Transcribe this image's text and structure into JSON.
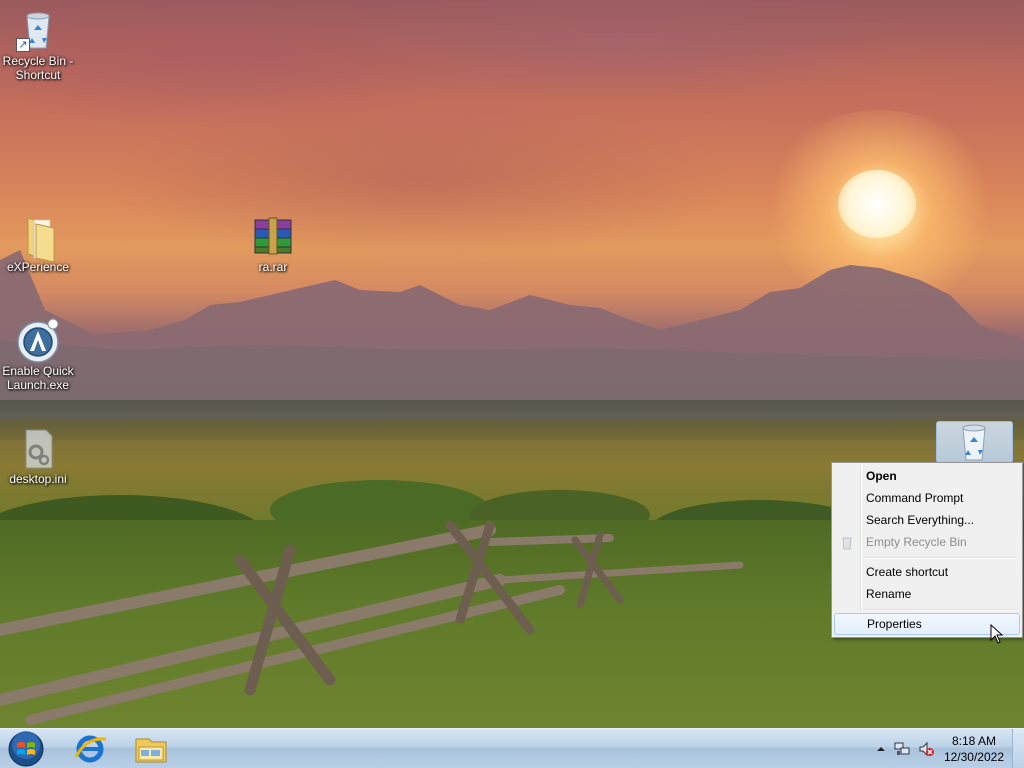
{
  "desktop_icons": [
    {
      "name": "recycle-bin-shortcut",
      "label": "Recycle Bin - Shortcut",
      "icon": "recycle-bin-icon"
    },
    {
      "name": "experience-folder",
      "label": "eXPerience",
      "icon": "folder-icon"
    },
    {
      "name": "ra-rar",
      "label": "ra.rar",
      "icon": "winrar-archive-icon"
    },
    {
      "name": "enable-quick-launch",
      "label": "Enable Quick Launch.exe",
      "icon": "autoit-icon"
    },
    {
      "name": "desktop-ini",
      "label": "desktop.ini",
      "icon": "settings-file-icon"
    },
    {
      "name": "recycle-bin",
      "label": "",
      "icon": "recycle-bin-icon"
    }
  ],
  "labels": {
    "recycle_bin_shortcut": "Recycle Bin - Shortcut",
    "experience": "eXPerience",
    "ra_rar": "ra.rar",
    "enable_quick_launch": "Enable Quick Launch.exe",
    "desktop_ini": "desktop.ini"
  },
  "context_menu": {
    "open": "Open",
    "command_prompt": "Command Prompt",
    "search_everything": "Search Everything...",
    "empty_recycle_bin": "Empty Recycle Bin",
    "create_shortcut": "Create shortcut",
    "rename": "Rename",
    "properties": "Properties"
  },
  "taskbar": {
    "pinned": [
      "start-orb-icon",
      "internet-explorer-icon",
      "windows-explorer-icon"
    ],
    "tray_icons": [
      "show-hidden-icons-arrow-icon",
      "network-icon",
      "volume-muted-icon"
    ],
    "time": "8:18 AM",
    "date": "12/30/2022"
  },
  "colors": {
    "taskbar": "#bcd2e8",
    "menu_bg": "#f0f0f0",
    "menu_hover_border": "#a8cbef"
  }
}
